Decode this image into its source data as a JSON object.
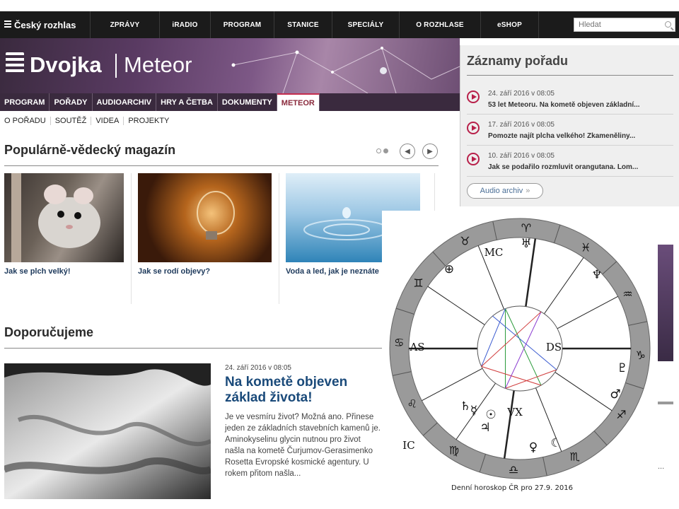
{
  "topnav": {
    "brand": "Český rozhlas",
    "items": [
      "ZPRÁVY",
      "iRADIO",
      "PROGRAM",
      "STANICE",
      "SPECIÁLY",
      "O ROZHLASE",
      "eSHOP"
    ],
    "search_placeholder": "Hledat"
  },
  "banner": {
    "station": "Dvojka",
    "show": "Meteor"
  },
  "subnav": {
    "items": [
      "PROGRAM",
      "POŘADY",
      "AUDIOARCHIV",
      "HRY A ČETBA",
      "DOKUMENTY",
      "METEOR"
    ],
    "active": "METEOR"
  },
  "tertnav": {
    "items": [
      "O POŘADU",
      "SOUTĚŽ",
      "VIDEA",
      "PROJEKTY"
    ]
  },
  "magazine": {
    "title": "Populárně-vědecký magazín",
    "cards": [
      {
        "caption": "Jak se plch velký!"
      },
      {
        "caption": "Jak se rodí objevy?"
      },
      {
        "caption": "Voda a led, jak je neznáte"
      }
    ]
  },
  "recommended": {
    "title": "Doporučujeme",
    "date": "24. září 2016 v 08:05",
    "headline": "Na kometě objeven základ života!",
    "text": "Je ve vesmíru život? Možná ano. Přinese jeden ze základních stavebních kamenů je. Aminokyselinu glycin nutnou pro život našla na kometě Čurjumov-Gerasimenko Rosetta Evropské kosmické agentury. U rokem přitom našla..."
  },
  "records": {
    "title": "Záznamy pořadu",
    "episodes": [
      {
        "date": "24. září 2016 v 08:05",
        "title": "53 let Meteoru. Na kometě objeven základní..."
      },
      {
        "date": "17. září 2016 v 08:05",
        "title": "Pomozte najít plcha velkého! Zkameněliny..."
      },
      {
        "date": "10. září 2016 v 08:05",
        "title": "Jak se podařilo rozmluvit orangutana. Lom..."
      }
    ],
    "archive_button": "Audio archiv"
  },
  "right_partial": {
    "ellipsis": "..."
  },
  "horoscope": {
    "caption": "Denní horoskop ČR pro 27.9. 2016",
    "signs": [
      "♉",
      "♈",
      "♓",
      "♒",
      "♑",
      "♐",
      "♏",
      "♎",
      "♍",
      "♌",
      "♋",
      "♊"
    ],
    "planets": [
      "♅",
      "♆",
      "♇",
      "♂",
      "♃",
      "♀",
      "☾",
      "☉",
      "♄",
      "☿",
      "⊕"
    ],
    "axis_labels": {
      "ascendant": "AS",
      "descendant": "DS",
      "midheaven": "MC",
      "imum_coeli": "IC",
      "vertex": "VX"
    }
  }
}
